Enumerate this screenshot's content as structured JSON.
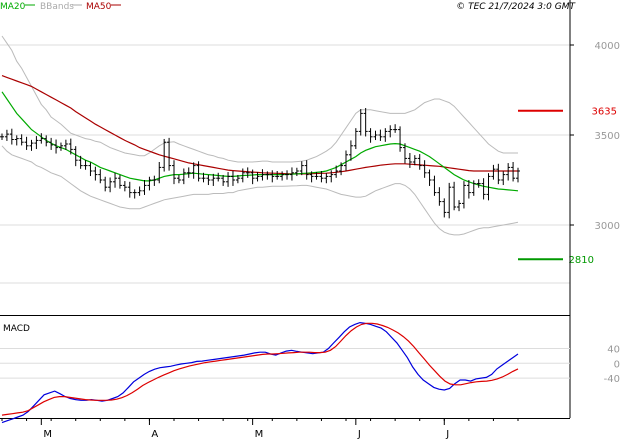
{
  "chart_data": [
    {
      "type": "line",
      "panel": "price",
      "copyright": "© TEC 21/7/2024 3:0 GMT",
      "legend": [
        {
          "name": "MA20",
          "color": "#00aa00"
        },
        {
          "name": "BBands",
          "color": "#aaaaaa"
        },
        {
          "name": "MA50",
          "color": "#aa0000"
        }
      ],
      "legend_placement": "top-left",
      "ylim": [
        2500,
        4250
      ],
      "y_ticks": [
        3000,
        3500,
        4000
      ],
      "y_tick_labels": [
        "3000",
        "3500",
        "4000"
      ],
      "grid": true,
      "x_months": [
        "M",
        "A",
        "M",
        "J",
        "J"
      ],
      "x_month_index": [
        8,
        30,
        51,
        72,
        90
      ],
      "n_bars": 106,
      "closes": [
        3490,
        3505,
        3475,
        3480,
        3460,
        3440,
        3455,
        3470,
        3480,
        3460,
        3445,
        3430,
        3440,
        3450,
        3420,
        3360,
        3330,
        3330,
        3300,
        3280,
        3250,
        3210,
        3240,
        3260,
        3220,
        3210,
        3180,
        3180,
        3190,
        3220,
        3250,
        3250,
        3320,
        3460,
        3330,
        3260,
        3250,
        3290,
        3290,
        3330,
        3260,
        3260,
        3250,
        3260,
        3260,
        3240,
        3270,
        3250,
        3260,
        3290,
        3290,
        3260,
        3270,
        3280,
        3280,
        3270,
        3270,
        3280,
        3280,
        3290,
        3300,
        3330,
        3280,
        3270,
        3270,
        3260,
        3270,
        3280,
        3300,
        3330,
        3390,
        3440,
        3520,
        3620,
        3520,
        3490,
        3500,
        3490,
        3520,
        3530,
        3530,
        3430,
        3370,
        3350,
        3370,
        3330,
        3290,
        3250,
        3180,
        3130,
        3070,
        3210,
        3100,
        3120,
        3220,
        3180,
        3230,
        3230,
        3170,
        3270,
        3310,
        3250,
        3280,
        3320,
        3260,
        3300
      ],
      "ma20": [
        3740,
        3700,
        3660,
        3620,
        3590,
        3560,
        3530,
        3510,
        3490,
        3470,
        3455,
        3440,
        3430,
        3420,
        3405,
        3390,
        3375,
        3360,
        3350,
        3335,
        3320,
        3310,
        3300,
        3290,
        3280,
        3270,
        3260,
        3255,
        3250,
        3245,
        3245,
        3250,
        3260,
        3270,
        3275,
        3280,
        3280,
        3282,
        3285,
        3288,
        3285,
        3282,
        3280,
        3278,
        3275,
        3272,
        3270,
        3270,
        3272,
        3275,
        3276,
        3278,
        3280,
        3280,
        3280,
        3280,
        3280,
        3280,
        3281,
        3282,
        3284,
        3286,
        3288,
        3290,
        3292,
        3295,
        3300,
        3310,
        3320,
        3335,
        3350,
        3365,
        3380,
        3400,
        3415,
        3425,
        3435,
        3440,
        3445,
        3450,
        3452,
        3450,
        3440,
        3430,
        3420,
        3410,
        3395,
        3380,
        3360,
        3340,
        3320,
        3300,
        3280,
        3265,
        3250,
        3240,
        3230,
        3222,
        3215,
        3210,
        3205,
        3200,
        3198,
        3195,
        3193,
        3190
      ],
      "ma50": [
        3830,
        3820,
        3810,
        3800,
        3790,
        3780,
        3770,
        3755,
        3740,
        3725,
        3710,
        3695,
        3680,
        3665,
        3650,
        3630,
        3612,
        3595,
        3578,
        3560,
        3545,
        3530,
        3515,
        3500,
        3485,
        3470,
        3457,
        3445,
        3430,
        3420,
        3410,
        3400,
        3390,
        3382,
        3375,
        3368,
        3360,
        3352,
        3345,
        3340,
        3335,
        3330,
        3325,
        3320,
        3315,
        3310,
        3305,
        3302,
        3300,
        3298,
        3296,
        3294,
        3292,
        3290,
        3289,
        3288,
        3287,
        3286,
        3285,
        3284,
        3284,
        3284,
        3284,
        3285,
        3286,
        3287,
        3288,
        3290,
        3293,
        3296,
        3300,
        3305,
        3310,
        3315,
        3320,
        3324,
        3328,
        3332,
        3335,
        3338,
        3340,
        3340,
        3340,
        3338,
        3336,
        3334,
        3332,
        3330,
        3328,
        3326,
        3322,
        3318,
        3314,
        3310,
        3306,
        3302,
        3300,
        3300,
        3300,
        3300,
        3300,
        3300,
        3300,
        3300,
        3300,
        3300
      ],
      "bb_upper": [
        4050,
        4010,
        3970,
        3910,
        3870,
        3820,
        3770,
        3720,
        3670,
        3640,
        3600,
        3580,
        3560,
        3535,
        3510,
        3500,
        3490,
        3480,
        3475,
        3465,
        3460,
        3445,
        3430,
        3420,
        3410,
        3400,
        3395,
        3390,
        3385,
        3385,
        3400,
        3420,
        3440,
        3455,
        3460,
        3462,
        3450,
        3440,
        3430,
        3420,
        3410,
        3400,
        3390,
        3385,
        3375,
        3370,
        3360,
        3355,
        3350,
        3350,
        3350,
        3350,
        3352,
        3355,
        3355,
        3350,
        3350,
        3350,
        3350,
        3350,
        3352,
        3355,
        3360,
        3370,
        3380,
        3395,
        3410,
        3430,
        3460,
        3500,
        3540,
        3580,
        3620,
        3640,
        3640,
        3640,
        3635,
        3630,
        3625,
        3620,
        3620,
        3620,
        3620,
        3630,
        3640,
        3660,
        3680,
        3690,
        3700,
        3700,
        3690,
        3680,
        3660,
        3630,
        3600,
        3570,
        3540,
        3510,
        3480,
        3450,
        3430,
        3410,
        3400,
        3400,
        3400,
        3400
      ],
      "bb_lower": [
        3440,
        3410,
        3390,
        3380,
        3370,
        3360,
        3350,
        3330,
        3320,
        3305,
        3290,
        3280,
        3270,
        3250,
        3230,
        3210,
        3190,
        3175,
        3160,
        3150,
        3140,
        3130,
        3120,
        3110,
        3100,
        3095,
        3090,
        3090,
        3090,
        3100,
        3110,
        3120,
        3130,
        3140,
        3145,
        3150,
        3155,
        3160,
        3165,
        3170,
        3170,
        3170,
        3170,
        3175,
        3175,
        3175,
        3180,
        3180,
        3190,
        3195,
        3200,
        3205,
        3210,
        3210,
        3212,
        3215,
        3215,
        3215,
        3216,
        3217,
        3218,
        3220,
        3220,
        3215,
        3210,
        3205,
        3200,
        3190,
        3180,
        3170,
        3165,
        3160,
        3155,
        3155,
        3160,
        3175,
        3190,
        3200,
        3210,
        3220,
        3230,
        3230,
        3220,
        3200,
        3170,
        3130,
        3090,
        3050,
        3010,
        2980,
        2960,
        2950,
        2945,
        2945,
        2950,
        2960,
        2970,
        2980,
        2985,
        2985,
        2990,
        2995,
        3000,
        3005,
        3010,
        3015
      ],
      "annotations": [
        {
          "value": 3635,
          "label": "3635",
          "color": "#dd0000"
        },
        {
          "value": 2810,
          "label": "2810",
          "color": "#009900"
        }
      ]
    },
    {
      "type": "line",
      "panel": "macd",
      "title": "MACD",
      "ylim": [
        -145,
        125
      ],
      "y_ticks": [
        40,
        0,
        -40
      ],
      "y_tick_labels": [
        "40",
        "0",
        "-40"
      ],
      "series": [
        {
          "color": "#0000dd",
          "values": [
            -160,
            -155,
            -150,
            -145,
            -140,
            -130,
            -115,
            -100,
            -85,
            -80,
            -75,
            -82,
            -90,
            -95,
            -98,
            -100,
            -100,
            -98,
            -100,
            -102,
            -100,
            -95,
            -90,
            -80,
            -65,
            -50,
            -40,
            -30,
            -22,
            -16,
            -12,
            -10,
            -8,
            -5,
            -2,
            0,
            2,
            5,
            6,
            8,
            10,
            12,
            14,
            16,
            18,
            20,
            22,
            25,
            28,
            30,
            30,
            25,
            22,
            28,
            33,
            35,
            32,
            30,
            28,
            26,
            28,
            30,
            40,
            55,
            70,
            85,
            98,
            105,
            110,
            108,
            105,
            100,
            95,
            85,
            70,
            55,
            35,
            15,
            -10,
            -30,
            -45,
            -55,
            -65,
            -70,
            -72,
            -68,
            -55,
            -45,
            -45,
            -48,
            -42,
            -40,
            -38,
            -30,
            -15,
            -5,
            5,
            15,
            25
          ]
        },
        {
          "color": "#dd0000",
          "values": [
            -140,
            -138,
            -136,
            -134,
            -132,
            -128,
            -120,
            -112,
            -104,
            -98,
            -92,
            -90,
            -90,
            -92,
            -94,
            -96,
            -98,
            -99,
            -100,
            -100,
            -100,
            -99,
            -97,
            -93,
            -87,
            -79,
            -70,
            -60,
            -52,
            -45,
            -38,
            -32,
            -26,
            -20,
            -15,
            -11,
            -7,
            -4,
            -1,
            2,
            4,
            6,
            8,
            10,
            12,
            14,
            16,
            18,
            20,
            22,
            24,
            25,
            25,
            26,
            27,
            28,
            29,
            30,
            30,
            30,
            29,
            29,
            30,
            35,
            45,
            60,
            75,
            88,
            98,
            105,
            108,
            108,
            106,
            102,
            97,
            90,
            82,
            72,
            60,
            45,
            28,
            12,
            -5,
            -20,
            -35,
            -48,
            -56,
            -58,
            -58,
            -55,
            -52,
            -50,
            -49,
            -48,
            -46,
            -42,
            -37,
            -30,
            -22,
            -15
          ]
        }
      ],
      "zero_line": false
    }
  ]
}
